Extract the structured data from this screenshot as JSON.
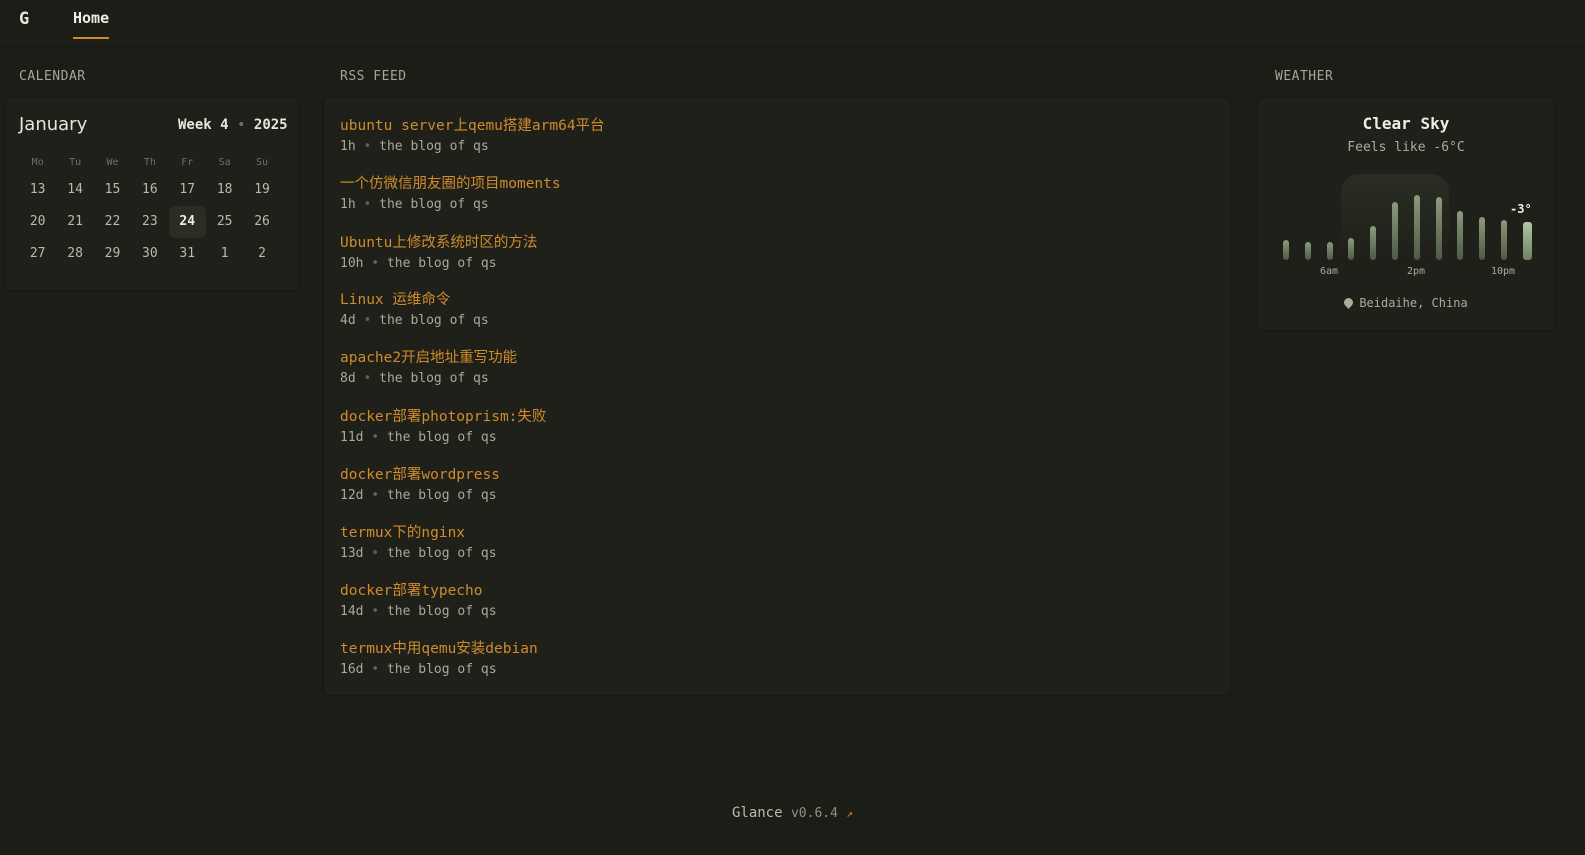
{
  "nav": {
    "logo": "G",
    "home": "Home"
  },
  "sections": {
    "calendar": "CALENDAR",
    "rss": "RSS FEED",
    "weather": "WEATHER"
  },
  "calendar": {
    "month": "January",
    "week": "Week 4",
    "year": "2025",
    "weekdays": [
      "Mo",
      "Tu",
      "We",
      "Th",
      "Fr",
      "Sa",
      "Su"
    ],
    "rows": [
      [
        "13",
        "14",
        "15",
        "16",
        "17",
        "18",
        "19"
      ],
      [
        "20",
        "21",
        "22",
        "23",
        "24",
        "25",
        "26"
      ],
      [
        "27",
        "28",
        "29",
        "30",
        "31",
        "1",
        "2"
      ]
    ],
    "today": "24"
  },
  "rss": {
    "items": [
      {
        "title": "ubuntu server上qemu搭建arm64平台",
        "age": "1h",
        "source": "the blog of qs"
      },
      {
        "title": "一个仿微信朋友圈的项目moments",
        "age": "1h",
        "source": "the blog of qs"
      },
      {
        "title": "Ubuntu上修改系统时区的方法",
        "age": "10h",
        "source": "the blog of qs"
      },
      {
        "title": "Linux 运维命令",
        "age": "4d",
        "source": "the blog of qs"
      },
      {
        "title": "apache2开启地址重写功能",
        "age": "8d",
        "source": "the blog of qs"
      },
      {
        "title": "docker部署photoprism:失败",
        "age": "11d",
        "source": "the blog of qs"
      },
      {
        "title": "docker部署wordpress",
        "age": "12d",
        "source": "the blog of qs"
      },
      {
        "title": "termux下的nginx",
        "age": "13d",
        "source": "the blog of qs"
      },
      {
        "title": "docker部署typecho",
        "age": "14d",
        "source": "the blog of qs"
      },
      {
        "title": "termux中用qemu安装debian",
        "age": "16d",
        "source": "the blog of qs"
      }
    ]
  },
  "weather": {
    "condition": "Clear Sky",
    "feels_like": "Feels like -6°C",
    "current_temp": "-3°",
    "ticks": [
      "6am",
      "2pm",
      "10pm"
    ],
    "bar_levels": [
      0.22,
      0.2,
      0.2,
      0.24,
      0.38,
      0.64,
      0.72,
      0.7,
      0.54,
      0.48,
      0.44,
      0.42
    ],
    "location": "Beidaihe, China"
  },
  "footer": {
    "app": "Glance",
    "version": "v0.6.4",
    "arrow": "↗"
  },
  "colors": {
    "accent": "#d08b2d",
    "background": "#1b1d17"
  }
}
